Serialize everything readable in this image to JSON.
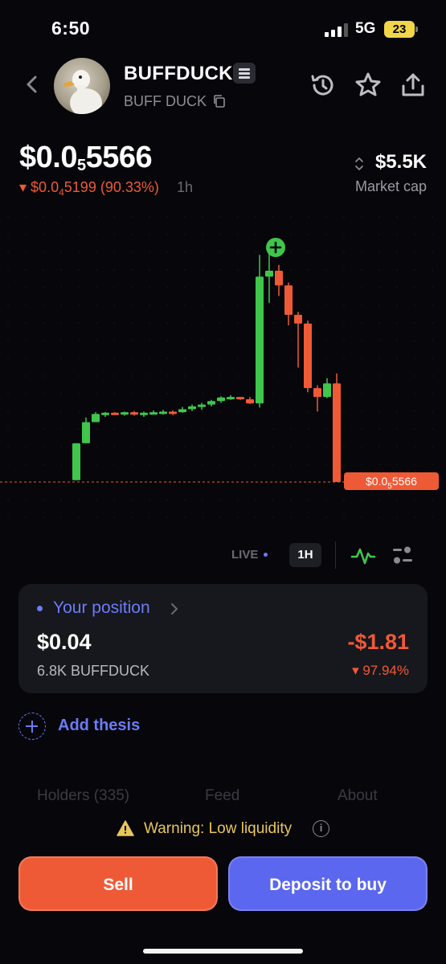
{
  "status_bar": {
    "time": "6:50",
    "network": "5G",
    "battery": "23"
  },
  "token": {
    "name": "BUFFDUCK",
    "subtitle": "BUFF DUCK"
  },
  "price": {
    "prefix": "$0.0",
    "zeros": "5",
    "digits": "5566"
  },
  "change": {
    "prefix": "$0.0",
    "zeros": "4",
    "digits": "5199",
    "pct": "(90.33%)",
    "period": "1h"
  },
  "market_cap": {
    "value": "$5.5K",
    "label": "Market cap"
  },
  "chart_data": {
    "type": "candlestick",
    "candles": [
      {
        "o": 8e-08,
        "h": 7.1e-07,
        "l": 8e-08,
        "c": 7.1e-07
      },
      {
        "o": 7.1e-07,
        "h": 1.15e-06,
        "l": 7.1e-07,
        "c": 1.07e-06
      },
      {
        "o": 1.07e-06,
        "h": 1.24e-06,
        "l": 1.07e-06,
        "c": 1.21e-06
      },
      {
        "o": 1.21e-06,
        "h": 1.24e-06,
        "l": 1.16e-06,
        "c": 1.23e-06
      },
      {
        "o": 1.23e-06,
        "h": 1.24e-06,
        "l": 1.19e-06,
        "c": 1.22e-06
      },
      {
        "o": 1.22e-06,
        "h": 1.25e-06,
        "l": 1.18e-06,
        "c": 1.24e-06
      },
      {
        "o": 1.24e-06,
        "h": 1.26e-06,
        "l": 1.18e-06,
        "c": 1.21e-06
      },
      {
        "o": 1.21e-06,
        "h": 1.25e-06,
        "l": 1.16e-06,
        "c": 1.23e-06
      },
      {
        "o": 1.23e-06,
        "h": 1.27e-06,
        "l": 1.21e-06,
        "c": 1.24e-06
      },
      {
        "o": 1.24e-06,
        "h": 1.28e-06,
        "l": 1.2e-06,
        "c": 1.25e-06
      },
      {
        "o": 1.25e-06,
        "h": 1.27e-06,
        "l": 1.19e-06,
        "c": 1.24e-06
      },
      {
        "o": 1.24e-06,
        "h": 1.33e-06,
        "l": 1.23e-06,
        "c": 1.29e-06
      },
      {
        "o": 1.29e-06,
        "h": 1.37e-06,
        "l": 1.26e-06,
        "c": 1.34e-06
      },
      {
        "o": 1.34e-06,
        "h": 1.4e-06,
        "l": 1.28e-06,
        "c": 1.37e-06
      },
      {
        "o": 1.37e-06,
        "h": 1.45e-06,
        "l": 1.34e-06,
        "c": 1.43e-06
      },
      {
        "o": 1.43e-06,
        "h": 1.51e-06,
        "l": 1.4e-06,
        "c": 1.49e-06
      },
      {
        "o": 1.49e-06,
        "h": 1.53e-06,
        "l": 1.45e-06,
        "c": 1.5e-06
      },
      {
        "o": 1.5e-06,
        "h": 1.5e-06,
        "l": 1.45e-06,
        "c": 1.46e-06
      },
      {
        "o": 1.46e-06,
        "h": 1.5e-06,
        "l": 1.38e-06,
        "c": 1.39e-06
      },
      {
        "o": 1.39e-06,
        "h": 3.92e-06,
        "l": 1.32e-06,
        "c": 3.55e-06
      },
      {
        "o": 3.55e-06,
        "h": 4.02e-06,
        "l": 3.1e-06,
        "c": 3.65e-06
      },
      {
        "o": 3.65e-06,
        "h": 3.75e-06,
        "l": 3.22e-06,
        "c": 3.4e-06
      },
      {
        "o": 3.4e-06,
        "h": 3.45e-06,
        "l": 2.72e-06,
        "c": 2.9e-06
      },
      {
        "o": 2.9e-06,
        "h": 2.95e-06,
        "l": 2e-06,
        "c": 2.75e-06
      },
      {
        "o": 2.75e-06,
        "h": 2.8e-06,
        "l": 1.58e-06,
        "c": 1.65e-06
      },
      {
        "o": 1.65e-06,
        "h": 1.7e-06,
        "l": 1.25e-06,
        "c": 1.5e-06
      },
      {
        "o": 1.5e-06,
        "h": 1.82e-06,
        "l": 1.48e-06,
        "c": 1.73e-06
      },
      {
        "o": 1.73e-06,
        "h": 1.9e-06,
        "l": 5e-08,
        "c": 5e-08
      }
    ],
    "current_price_label": {
      "prefix": "$0.0",
      "zeros": "5",
      "digits": "5566"
    },
    "up_color": "#3fc64b",
    "down_color": "#ef5a36"
  },
  "chart_controls": {
    "live": "LIVE",
    "timeframe": "1H"
  },
  "position": {
    "title": "Your position",
    "value": "$0.04",
    "amount": "6.8K BUFFDUCK",
    "pnl": "-$1.81",
    "pnl_pct": "97.94%"
  },
  "thesis": {
    "label": "Add thesis"
  },
  "tabs": [
    "Holders (335)",
    "Feed",
    "About"
  ],
  "warning": {
    "text": "Warning: Low liquidity"
  },
  "actions": {
    "sell": "Sell",
    "buy": "Deposit to buy"
  },
  "colors": {
    "accent": "#6b7cf5",
    "negative": "#ef5a36",
    "positive": "#3fc64b",
    "warning": "#e8c65a"
  }
}
